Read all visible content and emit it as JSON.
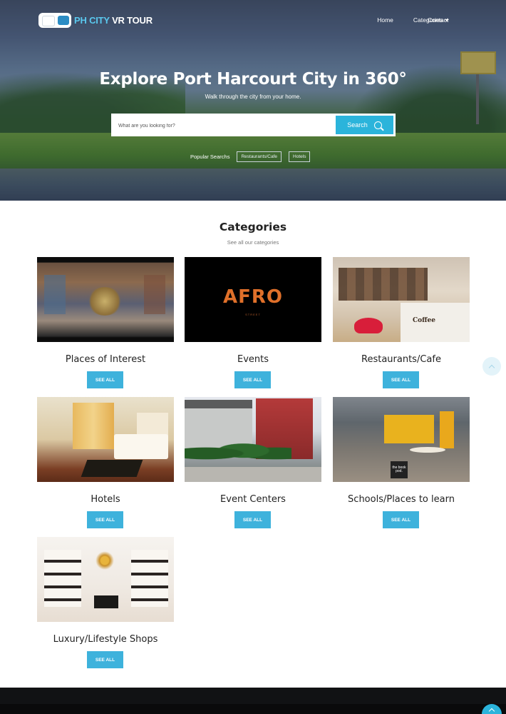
{
  "nav": {
    "logo_ph": "PH CITY",
    "logo_rest": " VR TOUR",
    "home": "Home",
    "categories": "Categories",
    "contact": "Contact"
  },
  "hero": {
    "title": "Explore Port Harcourt City in 360°",
    "subtitle": "Walk through the city from your home.",
    "search_placeholder": "What are you looking for?",
    "search_button": "Search",
    "popular_label": "Popular Searchs",
    "popular_tags": [
      "Restaurants/Cafe",
      "Hotels"
    ]
  },
  "categories": {
    "title": "Categories",
    "subtitle": "See all our categories",
    "button_label": "SEE ALL",
    "items": [
      {
        "name": "Places of Interest"
      },
      {
        "name": "Events",
        "image_text": "AFRO",
        "image_subtext": "STREET"
      },
      {
        "name": "Restaurants/Cafe",
        "image_text": "Coffee"
      },
      {
        "name": "Hotels"
      },
      {
        "name": "Event Centers"
      },
      {
        "name": "Schools/Places to learn",
        "image_text": "the book pod."
      },
      {
        "name": "Luxury/Lifestyle Shops"
      }
    ]
  },
  "icons": {
    "logo": "vr-goggles-icon",
    "search": "search-icon",
    "scroll_top": "chevron-up-icon"
  },
  "colors": {
    "accent": "#2bb4db",
    "button": "#3eb2dc",
    "footer": "#111214"
  }
}
